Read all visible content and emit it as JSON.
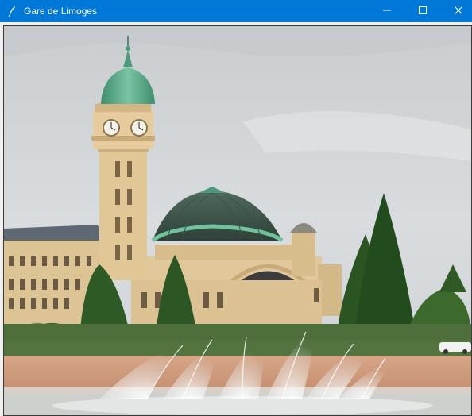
{
  "window": {
    "title": "Gare de Limoges",
    "icon": "feather-icon",
    "controls": {
      "minimize_icon": "minimize-icon",
      "maximize_icon": "maximize-icon",
      "close_icon": "close-icon"
    }
  },
  "canvas": {
    "content": "photo",
    "subject_icon": "gare-de-limoges-photo"
  },
  "colors": {
    "titlebar": "#0078d7",
    "sky": "#d4d7d9",
    "stone": "#e1c99c",
    "copper_roof": "#5fae8c",
    "trees": "#2f5a26",
    "water_spray": "#eef3f6",
    "plaza": "#cf9c7c"
  }
}
